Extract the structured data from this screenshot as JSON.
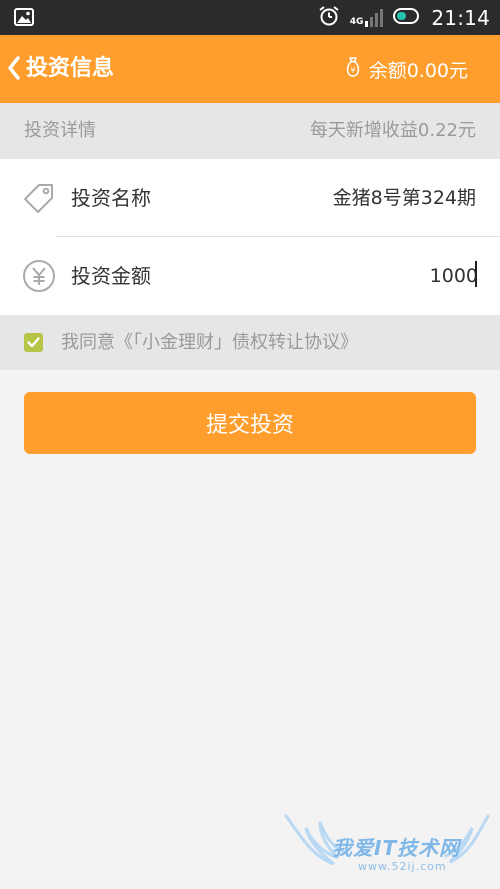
{
  "status_bar": {
    "network": "4G",
    "time": "21:14",
    "icons": [
      "gallery-icon",
      "alarm-icon",
      "signal-icon",
      "battery-icon"
    ]
  },
  "header": {
    "title": "投资信息",
    "balance_label": "余额0.00元",
    "icons": [
      "back-arrow-icon",
      "money-bag-icon"
    ]
  },
  "section": {
    "title": "投资详情",
    "daily_income": "每天新增收益0.22元"
  },
  "form": {
    "name_label": "投资名称",
    "name_value": "金猪8号第324期",
    "amount_label": "投资金额",
    "amount_value": "1000",
    "icons": [
      "price-tag-icon",
      "yuan-icon"
    ]
  },
  "agreement": {
    "checked": true,
    "text": "我同意《「小金理财」债权转让协议》"
  },
  "submit": {
    "label": "提交投资"
  },
  "watermark": {
    "text": "我爱IT技术网",
    "url": "www.52ij.com"
  },
  "colors": {
    "accent": "#ff9e2c",
    "status_bar": "#2b2b2b",
    "section_bg": "#e6e6e6",
    "checkbox": "#b6c447",
    "battery": "#27c3b3"
  }
}
